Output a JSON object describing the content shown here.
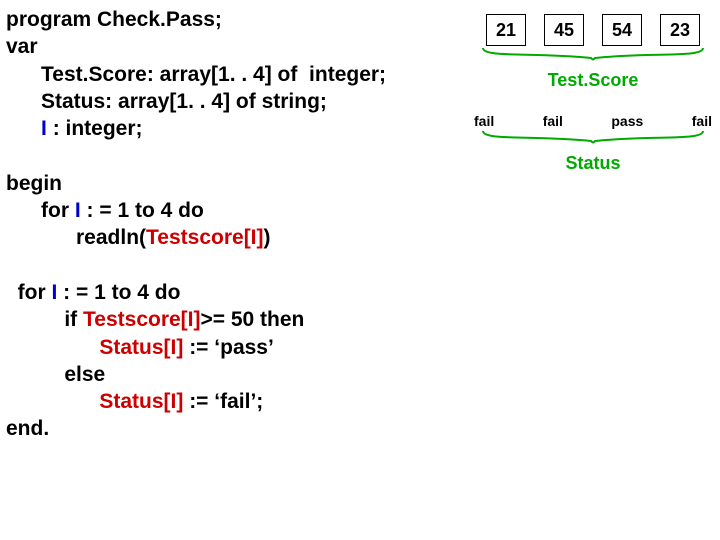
{
  "code": {
    "l1a": "program Check.Pass;",
    "l2a": "var",
    "l3a": "      Test.Score: array[1. . 4] of  integer;",
    "l4a": "      Status: array[1. . 4] of string;",
    "l5a": "      ",
    "l5b": "I",
    "l5c": " : integer;",
    "l6a": "begin",
    "l7a": "      for ",
    "l7b": "I",
    "l7c": " : = 1 to 4 do",
    "l8a": "            readln(",
    "l8b": "Testscore[I]",
    "l8c": ")",
    "l9a": "  for ",
    "l9b": "I",
    "l9c": " : = 1 to 4 do",
    "l10a": "          if ",
    "l10b": "Testscore[I]",
    "l10c": ">= 50 then",
    "l11a": "                ",
    "l11b": "Status[I]",
    "l11c": " := ‘pass’",
    "l12a": "          else",
    "l13a": "                ",
    "l13b": "Status[I]",
    "l13c": " := ‘fail’;",
    "l14a": "end."
  },
  "arrays": {
    "scores": [
      "21",
      "45",
      "54",
      "23"
    ],
    "score_label": "Test.Score",
    "statuses": [
      "fail",
      "fail",
      "pass",
      "fail"
    ],
    "status_label": "Status"
  }
}
